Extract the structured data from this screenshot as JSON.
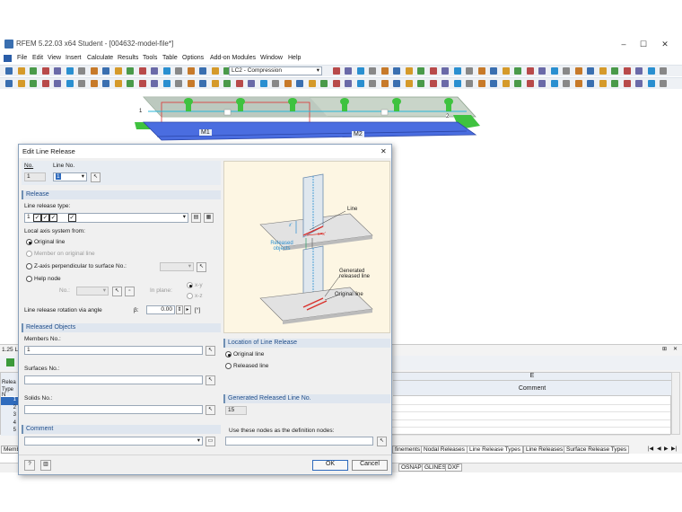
{
  "app": {
    "title": "RFEM 5.22.03 x64 Student - [004632-model-file*]",
    "window_controls": [
      "–",
      "☐",
      "✕"
    ],
    "menu": [
      "File",
      "Edit",
      "View",
      "Insert",
      "Calculate",
      "Results",
      "Tools",
      "Table",
      "Options",
      "Add-on Modules",
      "Window",
      "Help"
    ],
    "load_case": "LC2 - Compression"
  },
  "model": {
    "members": [
      "M1",
      "M2"
    ],
    "node_labels": [
      "1",
      "2"
    ]
  },
  "dialog": {
    "title": "Edit Line Release",
    "close": "✕",
    "no_label": "No.",
    "no_value": "1",
    "line_no_label": "Line No.",
    "line_no_value": "1",
    "release_section": "Release",
    "line_release_type_label": "Line release type:",
    "line_release_type_value": "1",
    "local_axis_label": "Local axis system from:",
    "opt_original_line": "Original line",
    "opt_member_on_original_line": "Member on original line",
    "opt_z_axis": "Z-axis perpendicular to surface No.:",
    "opt_help_node": "Help node",
    "help_node_no_label": "No.:",
    "in_plane_label": "In plane:",
    "plane_xy": "x-y",
    "plane_xz": "x-z",
    "rotation_label": "Line release rotation via angle",
    "rotation_symbol": "β:",
    "rotation_value": "0.00",
    "rotation_unit": "[°]",
    "released_objects_section": "Released Objects",
    "members_label": "Members No.:",
    "members_value": "1",
    "surfaces_label": "Surfaces No.:",
    "surfaces_value": "",
    "solids_label": "Solids No.:",
    "solids_value": "",
    "comment_section": "Comment",
    "comment_value": "",
    "location_section": "Location of Line Release",
    "loc_original_line": "Original line",
    "loc_released_line": "Released line",
    "generated_section": "Generated Released Line No.",
    "generated_value": "15",
    "definition_nodes_label": "Use these nodes as the definition nodes:",
    "definition_nodes_value": "",
    "ok": "OK",
    "cancel": "Cancel",
    "diagram": {
      "line": "Line",
      "released_objects": "Released objects",
      "generated_released_line": "Generated released line",
      "original_line": "Original line",
      "axis_z": "z'",
      "axis_x": "x=x'"
    }
  },
  "table": {
    "pane_title": "1.25 L",
    "column_e": "E",
    "column_comment": "Comment",
    "row_header_line1": "Relea",
    "row_header_line2": "Type N",
    "rows": [
      "1",
      "2",
      "3",
      "4",
      "5"
    ],
    "tabs": [
      "Memb",
      "finements",
      "Nodal Releases",
      "Line Release Types",
      "Line Releases",
      "Surface Release Types"
    ],
    "nav": [
      "|◀",
      "◀",
      "▶",
      "▶|"
    ]
  },
  "statusbar": [
    "OSNAP",
    "GLINES",
    "DXF"
  ],
  "colors": {
    "accent": "#2f6bbd",
    "section_bg": "#dfe6ef",
    "member_blue": "#4a6de0",
    "support_green": "#33cc33",
    "release_red": "#d9312c",
    "diagram_bg": "#fdf6e3",
    "annotation_blue": "#2a8fd0"
  }
}
